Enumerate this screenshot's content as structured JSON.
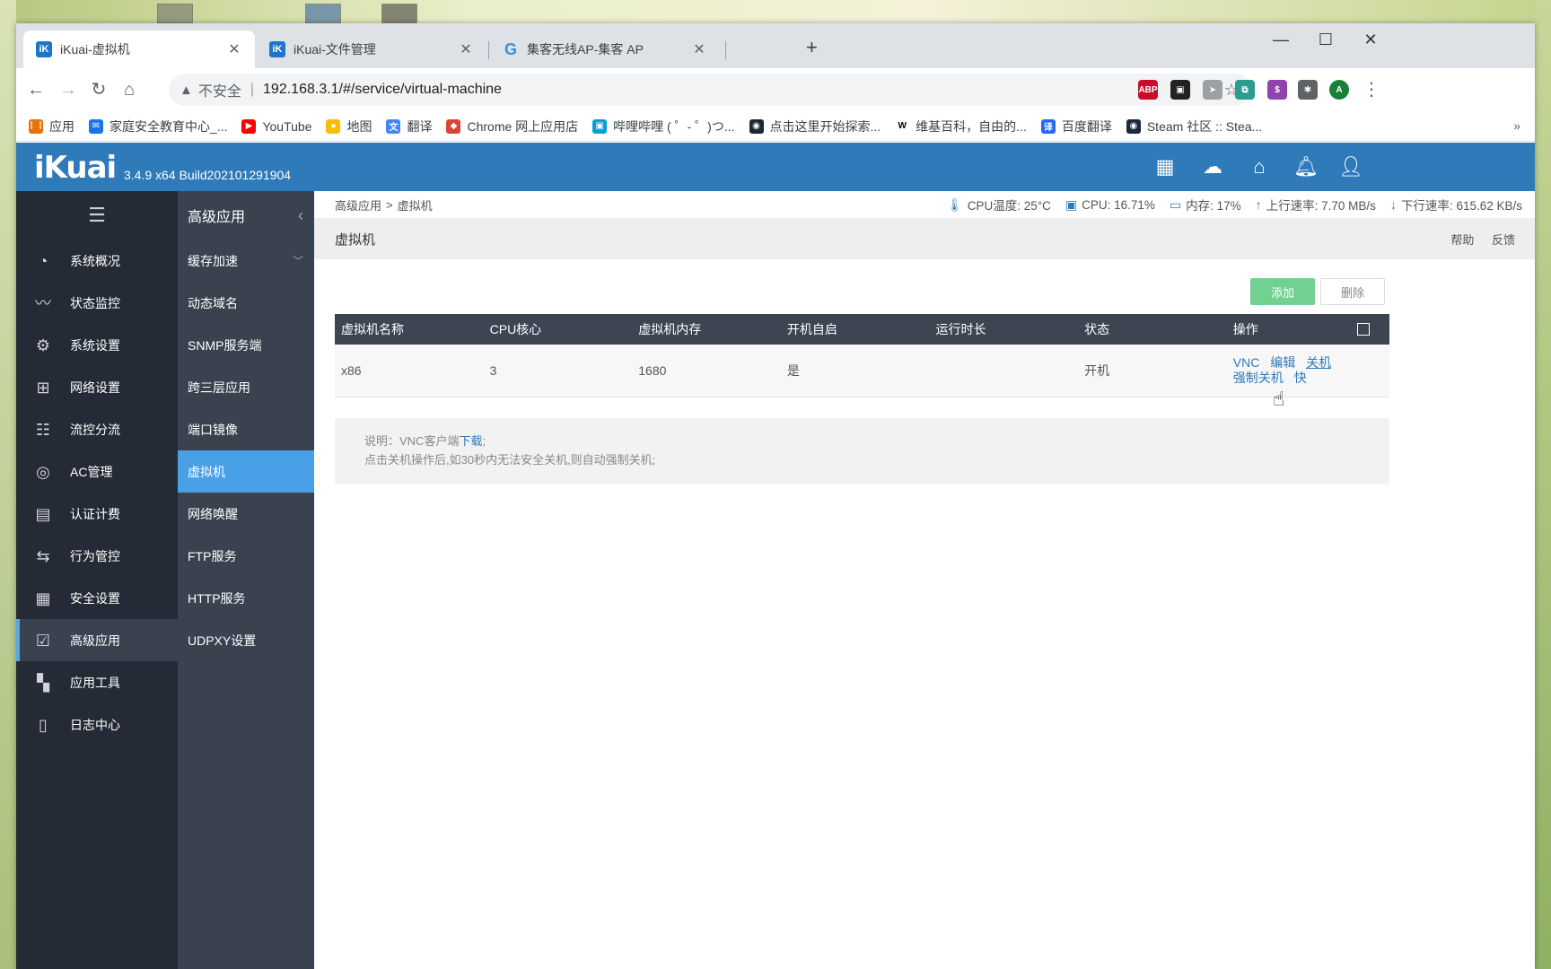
{
  "browser": {
    "tabs": [
      {
        "title": "iKuai-虚拟机",
        "icon": "iK",
        "active": true
      },
      {
        "title": "iKuai-文件管理",
        "icon": "iK",
        "active": false
      },
      {
        "title": "集客无线AP-集客 AP",
        "icon": "G",
        "active": false
      }
    ],
    "new_tab": "+",
    "window_controls": {
      "minimize": "—",
      "maximize": "☐",
      "close": "✕"
    },
    "address": {
      "security_label": "不安全",
      "url": "192.168.3.1/#/service/virtual-machine"
    },
    "extensions": [
      {
        "name": "abp-icon",
        "label": "ABP",
        "color": "#c70d2c"
      },
      {
        "name": "extension-icon-2",
        "label": "▣",
        "color": "#222222"
      },
      {
        "name": "extension-icon-3",
        "label": "➤",
        "color": "#9aa0a6"
      },
      {
        "name": "extension-icon-4",
        "label": "⧉",
        "color": "#2a9d8f"
      },
      {
        "name": "extension-icon-5",
        "label": "$",
        "color": "#8e44ad"
      },
      {
        "name": "puzzle-icon",
        "label": "✱",
        "color": "#5f6368"
      },
      {
        "name": "profile-avatar",
        "label": "A",
        "color": "#188038"
      }
    ],
    "bookmarks": [
      {
        "label": "应用",
        "icon": "apps-grid-icon",
        "color": "#e8710a"
      },
      {
        "label": "家庭安全教育中心_...",
        "icon": "mail-icon",
        "color": "#1a73e8"
      },
      {
        "label": "YouTube",
        "icon": "youtube-icon",
        "color": "#ff0000"
      },
      {
        "label": "地图",
        "icon": "map-pin-icon",
        "color": "#fbbc04"
      },
      {
        "label": "翻译",
        "icon": "translate-icon",
        "color": "#4285f4"
      },
      {
        "label": "Chrome 网上应用店",
        "icon": "chrome-store-icon",
        "color": "#db4437"
      },
      {
        "label": "哔哩哔哩 ( ゜- ゜)つ...",
        "icon": "bilibili-icon",
        "color": "#00a1d6"
      },
      {
        "label": "点击这里开始探索...",
        "icon": "steam-icon",
        "color": "#1b2838"
      },
      {
        "label": "维基百科，自由的...",
        "icon": "wikipedia-icon",
        "color": "#000000"
      },
      {
        "label": "百度翻译",
        "icon": "baidu-translate-icon",
        "color": "#2468f2"
      },
      {
        "label": "Steam 社区 :: Stea...",
        "icon": "steam-community-icon",
        "color": "#1b2838"
      }
    ],
    "bookmarks_more": "»"
  },
  "app": {
    "logo": "iKuai",
    "build": "3.4.9 x64 Build202101291904",
    "header_icons": [
      "apps-icon",
      "cloud-icon",
      "home-icon",
      "bell-icon",
      "user-icon"
    ],
    "colors": {
      "header": "#2f7ab8",
      "sidebar": "#242b36",
      "submenu": "#3a4250",
      "active": "#4aa0e6",
      "add_button": "#5ac87e"
    },
    "main_menu": [
      {
        "label": "系统概况",
        "icon": "dashboard-icon"
      },
      {
        "label": "状态监控",
        "icon": "monitor-icon"
      },
      {
        "label": "系统设置",
        "icon": "gear-icon"
      },
      {
        "label": "网络设置",
        "icon": "network-icon"
      },
      {
        "label": "流控分流",
        "icon": "sliders-icon"
      },
      {
        "label": "AC管理",
        "icon": "wifi-icon"
      },
      {
        "label": "认证计费",
        "icon": "id-card-icon"
      },
      {
        "label": "行为管控",
        "icon": "exchange-icon"
      },
      {
        "label": "安全设置",
        "icon": "firewall-icon"
      },
      {
        "label": "高级应用",
        "icon": "checkbox-icon",
        "active": true
      },
      {
        "label": "应用工具",
        "icon": "grid-icon"
      },
      {
        "label": "日志中心",
        "icon": "document-icon"
      }
    ],
    "submenu": {
      "title": "高级应用",
      "items": [
        {
          "label": "缓存加速",
          "expandable": true
        },
        {
          "label": "动态域名"
        },
        {
          "label": "SNMP服务端"
        },
        {
          "label": "跨三层应用"
        },
        {
          "label": "端口镜像"
        },
        {
          "label": "虚拟机",
          "active": true
        },
        {
          "label": "网络唤醒"
        },
        {
          "label": "FTP服务"
        },
        {
          "label": "HTTP服务"
        },
        {
          "label": "UDPXY设置"
        }
      ]
    },
    "breadcrumb": {
      "parent": "高级应用",
      "separator": ">",
      "current": "虚拟机"
    },
    "stats": {
      "cpu_temp": "CPU温度: 25°C",
      "cpu": "CPU: 16.71%",
      "memory": "内存: 17%",
      "upload": "上行速率: 7.70 MB/s",
      "download": "下行速率: 615.62 KB/s"
    },
    "page_title": "虚拟机",
    "help": "帮助",
    "feedback": "反馈",
    "buttons": {
      "add": "添加",
      "delete": "删除"
    },
    "table": {
      "headers": [
        "虚拟机名称",
        "CPU核心",
        "虚拟机内存",
        "开机自启",
        "运行时长",
        "状态",
        "操作"
      ],
      "rows": [
        {
          "name": "x86",
          "cpu": "3",
          "memory": "1680",
          "autostart": "是",
          "uptime": "",
          "status": "开机",
          "ops": [
            "VNC",
            "编辑",
            "关机",
            "强制关机",
            "快"
          ]
        }
      ]
    },
    "notice": {
      "line1_prefix": "说明：VNC客户端",
      "line1_link": "下载",
      "line1_suffix": ";",
      "line2": "点击关机操作后,如30秒内无法安全关机,则自动强制关机;"
    }
  }
}
